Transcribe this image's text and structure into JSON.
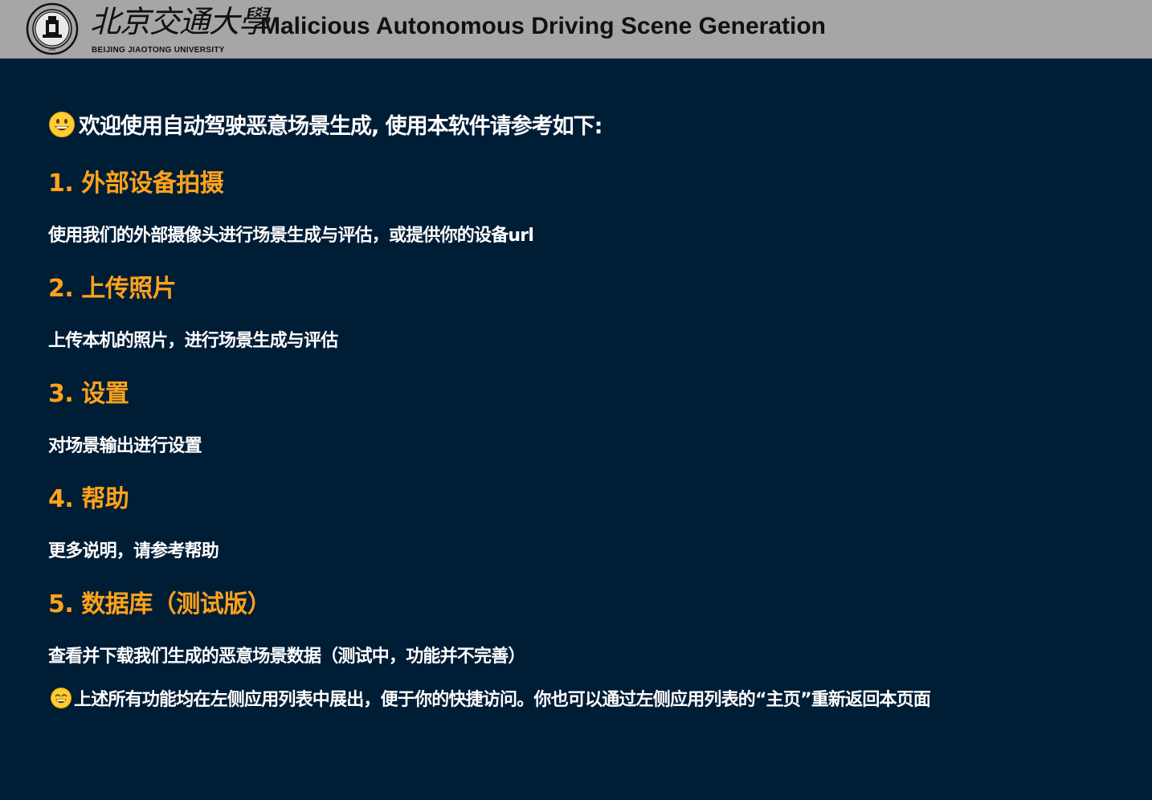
{
  "header": {
    "logo_cn": "北京交通大學",
    "logo_en": "BEIJING JIAOTONG UNIVERSITY",
    "app_title": "Malicious Autonomous Driving Scene Generation"
  },
  "main": {
    "welcome": "欢迎使用自动驾驶恶意场景生成, 使用本软件请参考如下:",
    "welcome_icon": "grinning-face-icon",
    "sections": [
      {
        "heading": "1. 外部设备拍摄",
        "desc": "使用我们的外部摄像头进行场景生成与评估，或提供你的设备url"
      },
      {
        "heading": "2. 上传照片",
        "desc": "上传本机的照片，进行场景生成与评估"
      },
      {
        "heading": "3. 设置",
        "desc": "对场景输出进行设置"
      },
      {
        "heading": "4. 帮助",
        "desc": "更多说明，请参考帮助"
      },
      {
        "heading": "5. 数据库（测试版）",
        "desc": "查看并下载我们生成的恶意场景数据（测试中，功能并不完善）"
      }
    ],
    "footer_note": "上述所有功能均在左侧应用列表中展出，便于你的快捷访问。你也可以通过左侧应用列表的“主页”重新返回本页面",
    "footer_icon": "smiling-face-icon"
  },
  "colors": {
    "background": "#001d36",
    "header": "#a6a6a6",
    "heading": "#ffa31a",
    "text": "#ffffff"
  }
}
